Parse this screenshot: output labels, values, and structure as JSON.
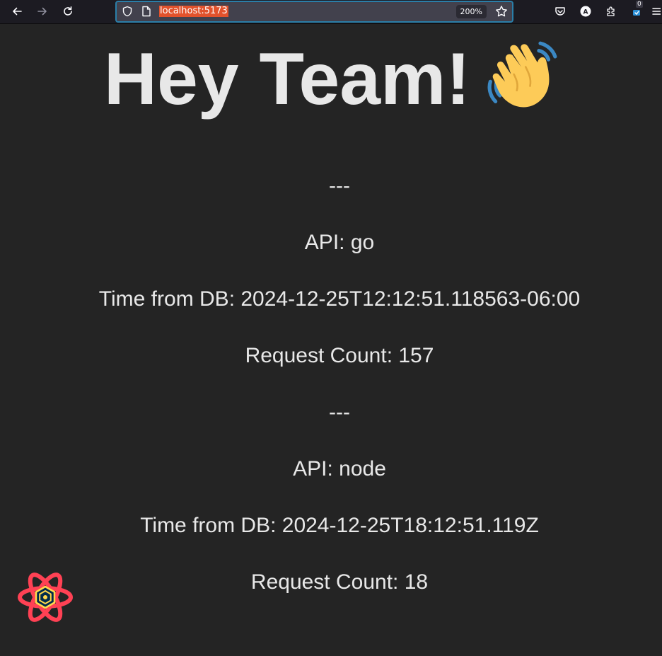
{
  "browser": {
    "url": "localhost:5173",
    "zoom": "200%",
    "extension_badge_count": "0"
  },
  "page": {
    "heading": "Hey Team!",
    "separator_1": "---",
    "api_1": "API: go",
    "time_1": "Time from DB: 2024-12-25T12:12:51.118563-06:00",
    "count_1": "Request Count: 157",
    "separator_2": "---",
    "api_2": "API: node",
    "time_2": "Time from DB: 2024-12-25T18:12:51.119Z",
    "count_2": "Request Count: 18"
  },
  "icons": {
    "wave": "waving-hand-emoji",
    "logo": "react-query-devtools-logo"
  },
  "colors": {
    "background": "#242424",
    "text": "#e8e8e8",
    "url_highlight": "#e2522c",
    "urlbar_border": "#2a7ea8"
  }
}
